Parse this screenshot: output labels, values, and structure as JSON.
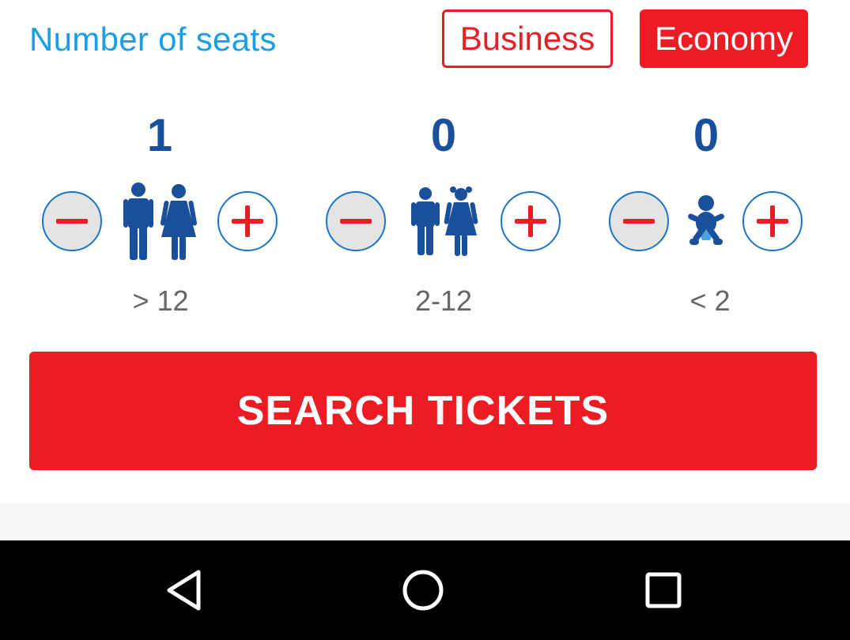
{
  "header": {
    "title": "Number of seats",
    "business_label": "Business",
    "economy_label": "Economy",
    "selected_class": "Economy"
  },
  "passengers": [
    {
      "count": "1",
      "range": "> 12",
      "icon": "adult-couple-icon"
    },
    {
      "count": "0",
      "range": "2-12",
      "icon": "children-icon"
    },
    {
      "count": "0",
      "range": "< 2",
      "icon": "infant-icon"
    }
  ],
  "search": {
    "label": "SEARCH TICKETS"
  },
  "navbar": {
    "back_icon": "back-icon",
    "home_icon": "home-icon",
    "recents_icon": "recents-icon"
  },
  "colors": {
    "accent_red": "#ec1c24",
    "title_blue": "#1a9ee6",
    "figure_blue": "#1a4f9c",
    "button_border_blue": "#1a75c9",
    "button_fill": "#e4e4e4"
  }
}
